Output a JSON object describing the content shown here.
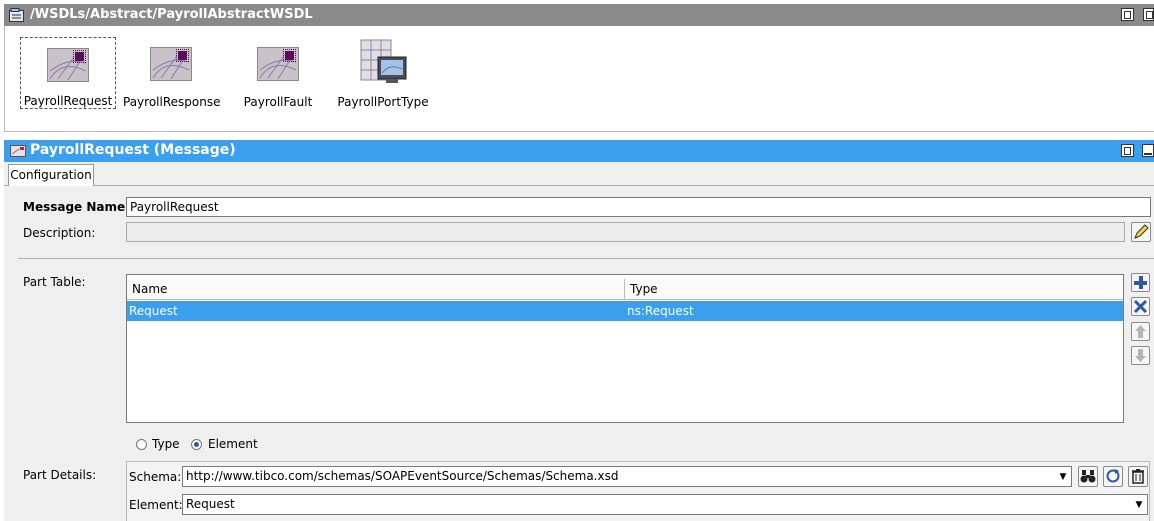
{
  "top_panel": {
    "title": "/WSDLs/Abstract/PayrollAbstractWSDL",
    "items": [
      {
        "label": "PayrollRequest",
        "icon": "message-icon",
        "selected": true
      },
      {
        "label": "PayrollResponse",
        "icon": "message-icon",
        "selected": false
      },
      {
        "label": "PayrollFault",
        "icon": "message-icon",
        "selected": false
      },
      {
        "label": "PayrollPortType",
        "icon": "port-type-icon",
        "selected": false
      }
    ]
  },
  "detail_panel": {
    "title": "PayrollRequest (Message)",
    "tab": "Configuration",
    "message_name_label": "Message Name:",
    "message_name_value": "PayrollRequest",
    "description_label": "Description:",
    "description_value": "",
    "part_table_label": "Part Table:",
    "table": {
      "columns": [
        "Name",
        "Type"
      ],
      "rows": [
        {
          "name": "Request",
          "type": "ns:Request",
          "selected": true
        }
      ]
    },
    "part_kind": {
      "options": [
        "Type",
        "Element"
      ],
      "selected": "Element"
    },
    "part_details_label": "Part Details:",
    "schema_label": "Schema:",
    "schema_value": "http://www.tibco.com/schemas/SOAPEventSource/Schemas/Schema.xsd",
    "element_label": "Element:",
    "element_value": "Request"
  },
  "colors": {
    "title_bar_gray": "#8a8a8a",
    "title_bar_blue": "#3b9ff0",
    "panel_bg": "#efefef",
    "selection_blue": "#3b9ff0"
  }
}
